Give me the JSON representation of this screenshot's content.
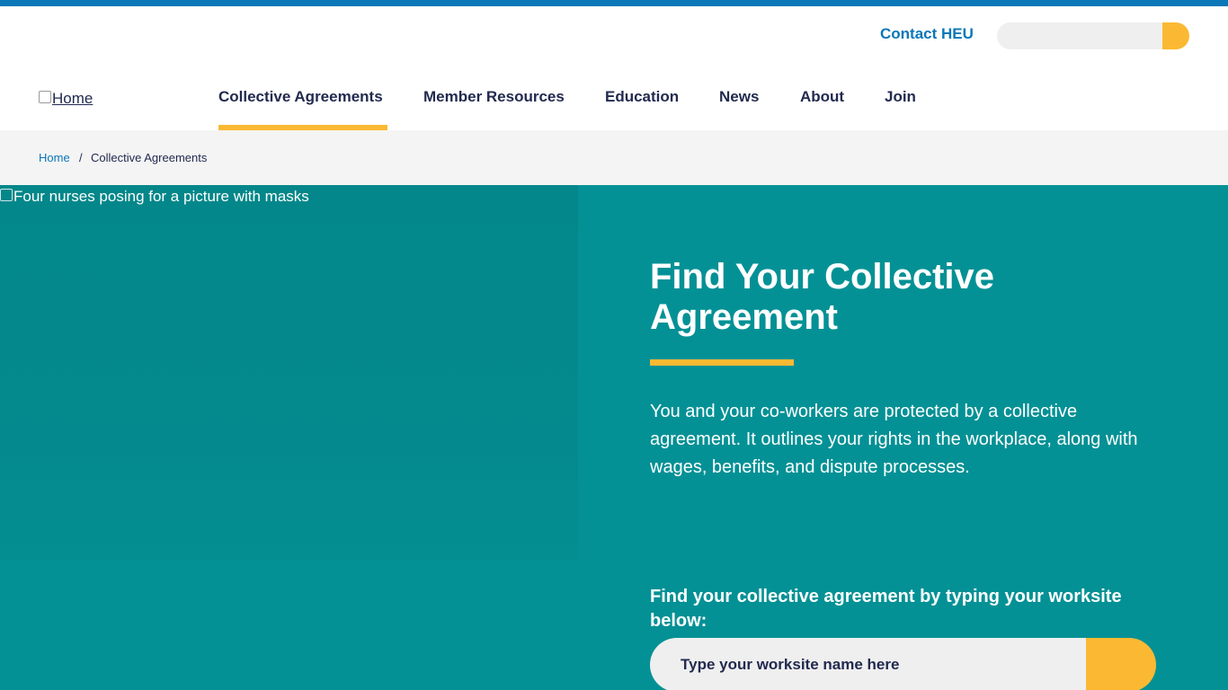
{
  "header": {
    "contact_label": "Contact HEU",
    "search_placeholder": "",
    "logo_alt": "Home"
  },
  "nav": {
    "items": [
      "Collective Agreements",
      "Member Resources",
      "Education",
      "News",
      "About",
      "Join"
    ],
    "active": "Collective Agreements"
  },
  "breadcrumb": {
    "home": "Home",
    "separator": "/",
    "current": "Collective Agreements"
  },
  "hero": {
    "image_alt": "Four nurses posing for a picture with masks",
    "title": "Find Your Collective Agreement",
    "description": "You and your co-workers are protected by a collective agreement. It outlines your rights in the workplace, along with wages, benefits, and dispute processes.",
    "search_label": "Find your collective agreement by typing your worksite below:",
    "search_placeholder": "Type your worksite name here"
  },
  "colors": {
    "brand_blue": "#0a77b8",
    "accent_yellow": "#fbb933",
    "hero_teal": "#049195",
    "navy_text": "#222a4f"
  }
}
